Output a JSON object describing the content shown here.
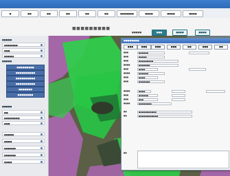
{
  "menu": {
    "items": [
      "■",
      "■■",
      "■■",
      "■■",
      "■■",
      "■■",
      "■■■■■■■",
      "■■■■",
      "■■■■",
      "■■■■"
    ]
  },
  "toolbar": {
    "stamp": "■■■■■■■■■",
    "label": "■■■■■",
    "buttons": [
      "■■■",
      "■■■■",
      "■■■■"
    ]
  },
  "sidebar": {
    "section1": "■■■■■",
    "items1": [
      "■■■■■■■",
      "■■■",
      "■■■■■"
    ],
    "section2": "■■■■■",
    "sub_buttons": [
      "■■■■■■■■■",
      "■■■■■■■■■■",
      "■■■■■■■■■■",
      "■■■■■■■■■■",
      "■■■■■■■",
      "■■■■■■■■"
    ],
    "section3": "■■■■■",
    "items2": [
      "■■",
      "■■■■■■■■",
      "■■■"
    ],
    "items3": [
      "■■■■■",
      "■■■■",
      "■■■■■■",
      "■■■■■■",
      "■■■■"
    ]
  },
  "dialog": {
    "title": "■■■■■■■■",
    "buttons": [
      "■■■",
      "■■■",
      "■■■",
      "■■■",
      "■■",
      "■■■",
      "■■"
    ],
    "fields": [
      {
        "label": "■■■",
        "value": "■■■■■■"
      },
      {
        "label": "■■■",
        "value": "■■■■■"
      },
      {
        "label": "■■■",
        "value": "■■■■■■■■■"
      },
      {
        "label": "■■■■",
        "value": "■■■■■■■"
      },
      {
        "label": "■■■",
        "value": "■■■■"
      },
      {
        "label": "■■■■",
        "value": "■■■■■■"
      },
      {
        "label": "■■■",
        "value": "■■■■"
      },
      {
        "label": "■■■",
        "value": "■■■■■■■"
      },
      {
        "label": "■■■■",
        "value": "■■■■"
      },
      {
        "label": "■■■",
        "value": "■■■■■■"
      },
      {
        "label": "■■■",
        "value": "■■■"
      },
      {
        "label": "■■■■",
        "value": "■■■■■■■■"
      },
      {
        "label": "■■",
        "value": "■■■■■■■■■■■"
      },
      {
        "label": "■■",
        "value": "■■■■■■■■■■■■"
      }
    ],
    "note_label": "■■"
  },
  "colors": {
    "topbar": "#3d7ecf",
    "map_green": "#2ed24a",
    "map_purple": "#b067b8",
    "accent": "#2d7d8f"
  }
}
